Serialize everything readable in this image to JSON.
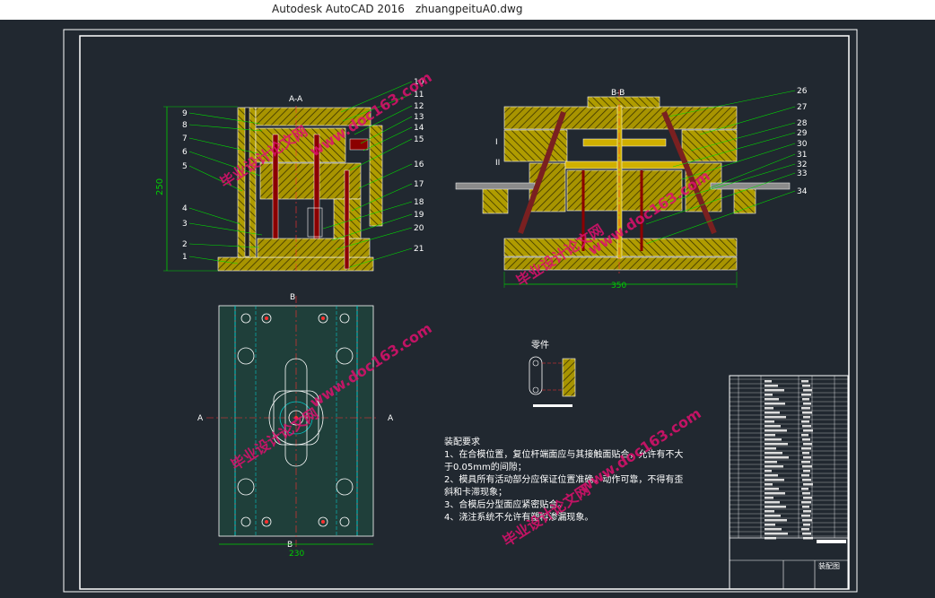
{
  "window": {
    "app_title": "Autodesk AutoCAD 2016",
    "file_name": "zhuangpeituA0.dwg"
  },
  "drawing": {
    "section_aa": "A-A",
    "section_bb": "B-B",
    "dim_height": "250",
    "dim_width_right": "350",
    "dim_width_plan": "230",
    "part_title": "零件",
    "roman_1": "I",
    "roman_2": "II",
    "left_callouts": [
      "9",
      "8",
      "7",
      "6",
      "5",
      "4",
      "3",
      "2",
      "1"
    ],
    "mid_callouts": [
      "10",
      "11",
      "12",
      "13",
      "14",
      "15",
      "16",
      "17",
      "18",
      "19",
      "20",
      "21"
    ],
    "right_callouts": [
      "26",
      "27",
      "28",
      "29",
      "30",
      "31",
      "32",
      "33",
      "34"
    ],
    "section_marks": {
      "a": "A",
      "b": "B"
    },
    "notes": {
      "title": "装配要求",
      "lines": [
        "1、在合模位置，复位杆端面应与其接触面贴合，允许有不大",
        "于0.05mm的间隙；",
        "2、模具所有活动部分应保证位置准确，动作可靠，不得有歪",
        "斜和卡滞现象；",
        "3、合模后分型面应紧密贴合。",
        "4、浇注系统不允许有塑料渗漏现象。"
      ]
    },
    "title_block_label": "装配图",
    "watermarks": [
      "www.doc163.com",
      "毕业设计论文网"
    ]
  },
  "colors": {
    "background": "#212830",
    "frame": "#ffffff",
    "hatch": "#c8b400",
    "dimension": "#00d000",
    "center": "#ff3030",
    "leader": "#00e000",
    "plan_fill": "#1f3f3a",
    "watermark": "#e0106e"
  }
}
